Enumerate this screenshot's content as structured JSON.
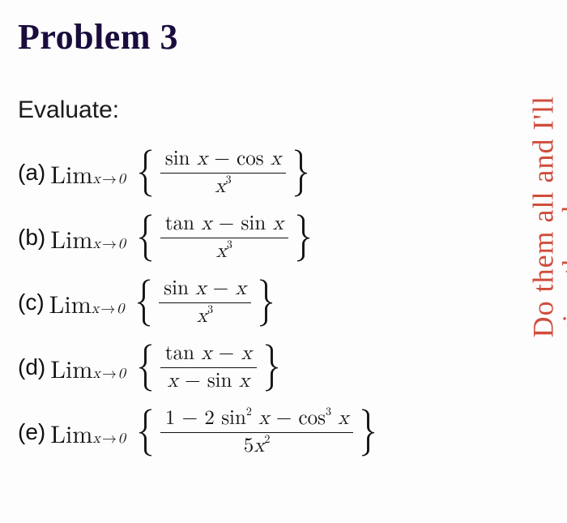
{
  "heading": "Problem 3",
  "prompt": "Evaluate:",
  "lim_word": "Lim",
  "sub_var": "x",
  "sub_arrow": "→",
  "sub_target": "0",
  "items": [
    {
      "label": "(a)",
      "numerator": "sin x − cos x",
      "denominator_var": "x",
      "denominator_exp": "3",
      "denominator_plain": ""
    },
    {
      "label": "(b)",
      "numerator": "tan x − sin x",
      "denominator_var": "x",
      "denominator_exp": "3",
      "denominator_plain": ""
    },
    {
      "label": "(c)",
      "numerator": "sin x − x",
      "denominator_var": "x",
      "denominator_exp": "3",
      "denominator_plain": ""
    },
    {
      "label": "(d)",
      "numerator": "tan x − x",
      "denominator_var": "",
      "denominator_exp": "",
      "denominator_plain": "x − sin x"
    },
    {
      "label": "(e)",
      "numerator": "1 − 2 sin² x − cos³ x",
      "denominator_var": "x",
      "denominator_exp": "2",
      "denominator_coef": "5",
      "denominator_plain": ""
    }
  ],
  "handwriting": {
    "line1": "Do them all and I'll",
    "line2": "give thumbs up"
  }
}
